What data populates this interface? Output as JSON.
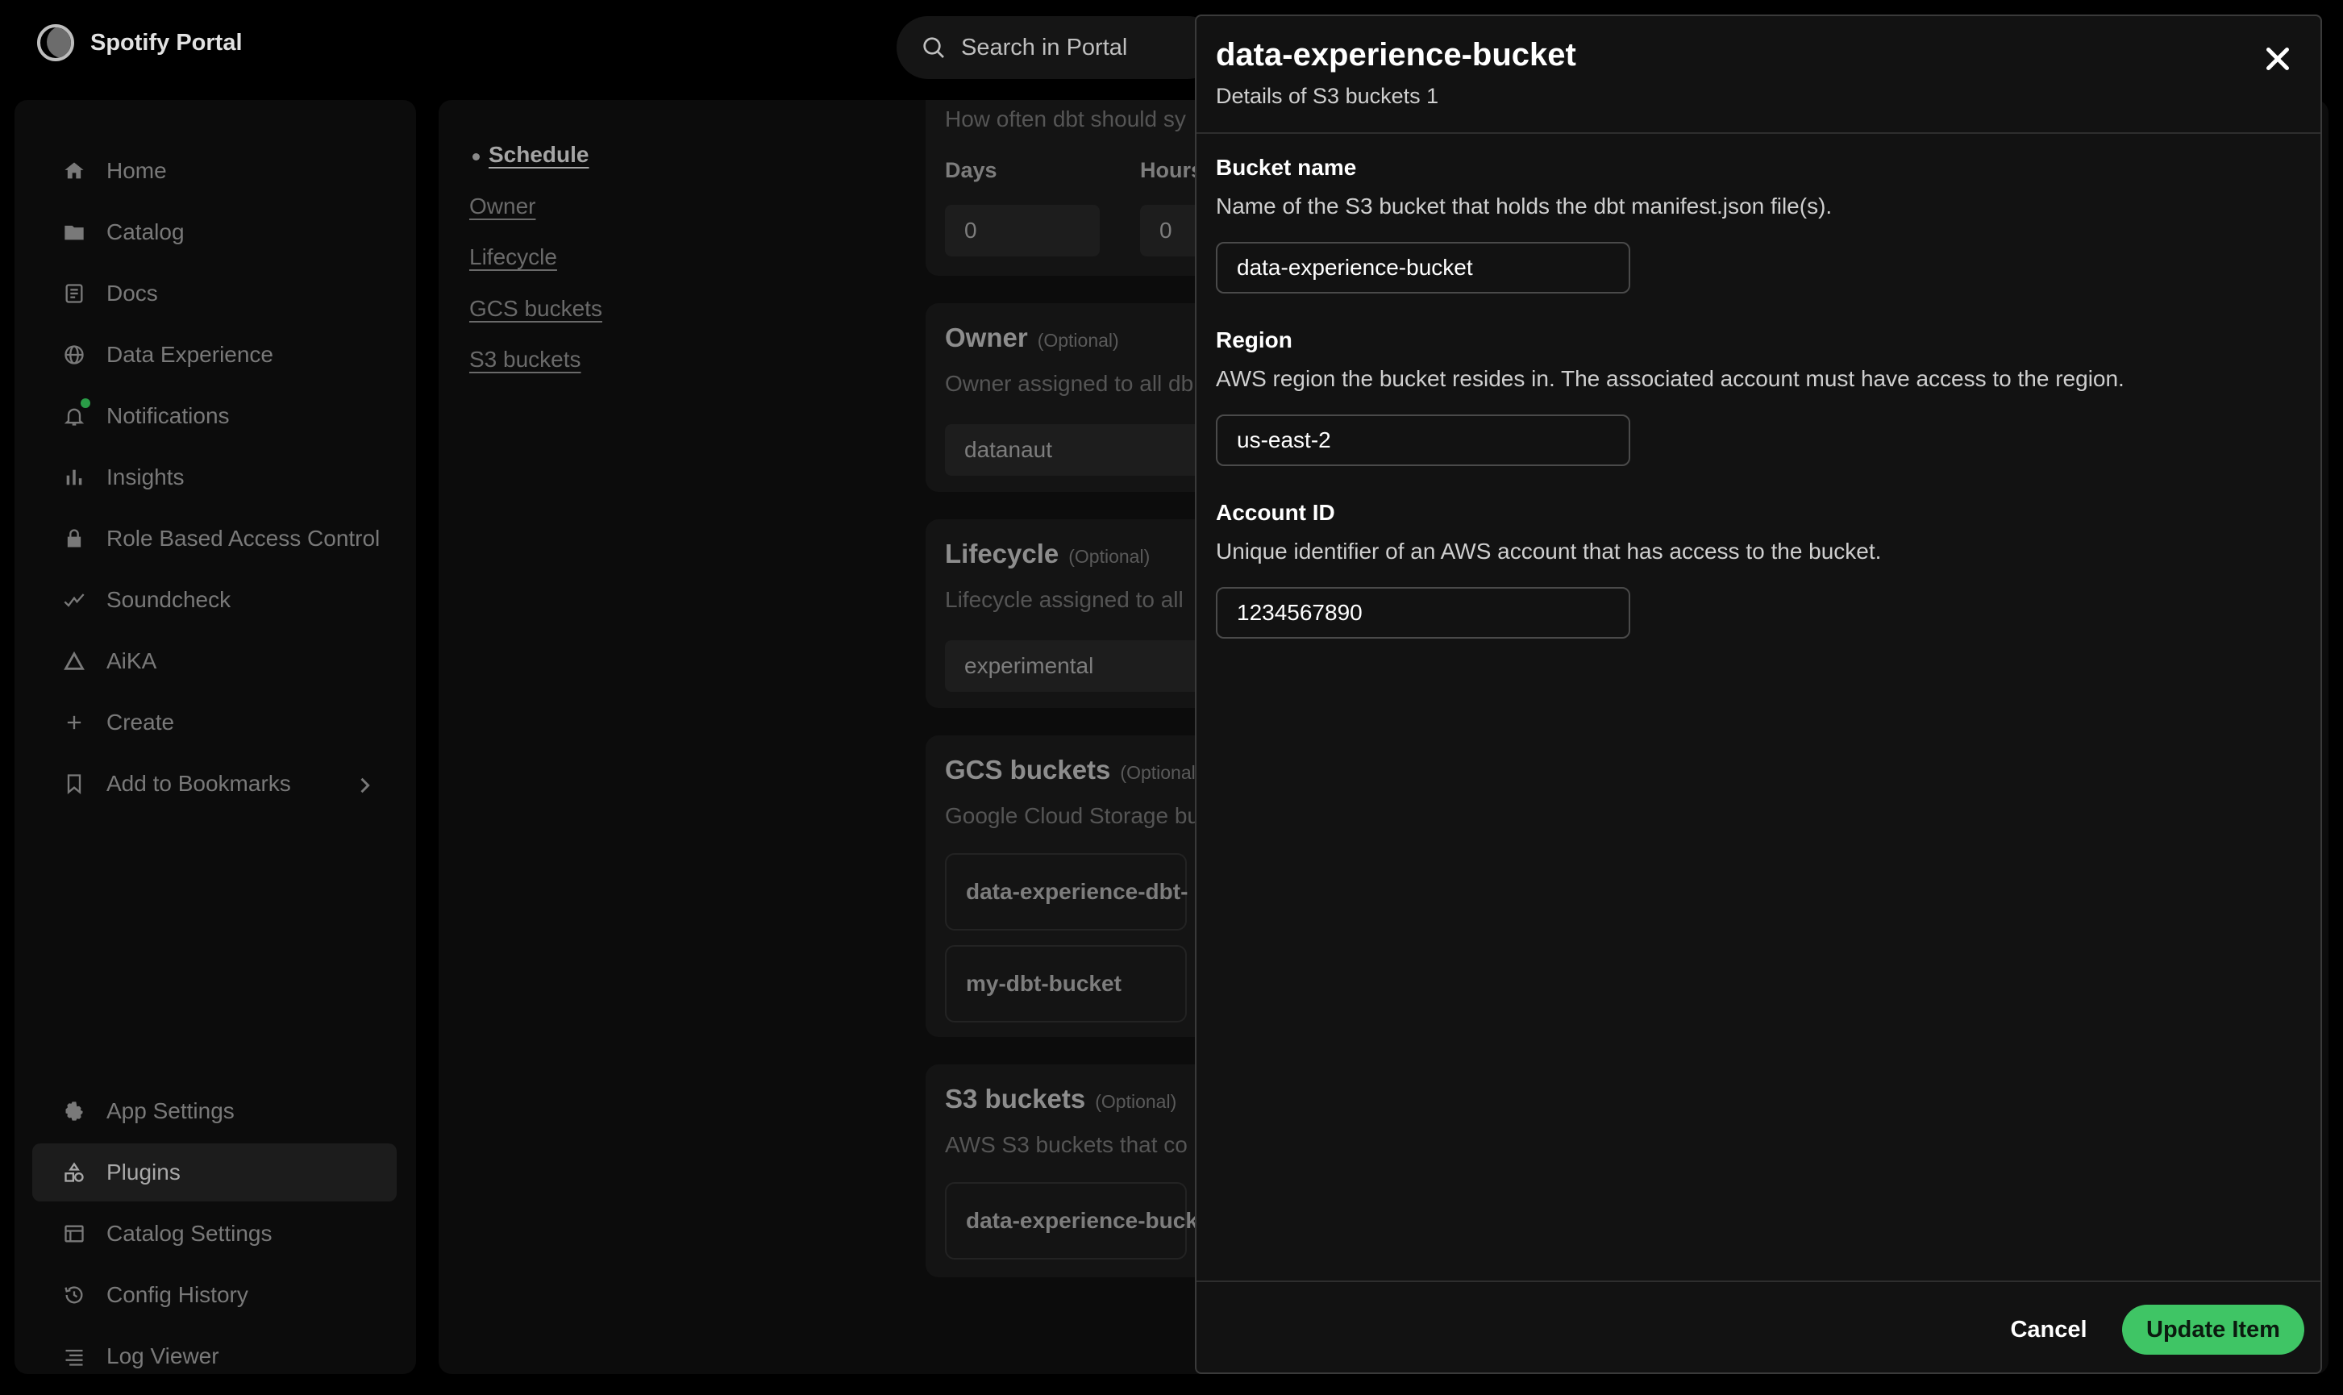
{
  "app": {
    "name": "Spotify Portal"
  },
  "search": {
    "placeholder": "Search in Portal"
  },
  "sidebar": {
    "items": [
      {
        "label": "Home",
        "icon": "home-icon"
      },
      {
        "label": "Catalog",
        "icon": "folder-icon"
      },
      {
        "label": "Docs",
        "icon": "docs-icon"
      },
      {
        "label": "Data Experience",
        "icon": "globe-icon"
      },
      {
        "label": "Notifications",
        "icon": "bell-icon"
      },
      {
        "label": "Insights",
        "icon": "bar-chart-icon"
      },
      {
        "label": "Role Based Access Control",
        "icon": "lock-icon"
      },
      {
        "label": "Soundcheck",
        "icon": "check-wave-icon"
      },
      {
        "label": "AiKA",
        "icon": "triangle-icon"
      },
      {
        "label": "Create",
        "icon": "plus-icon"
      },
      {
        "label": "Add to Bookmarks",
        "icon": "bookmark-icon"
      }
    ],
    "bottom_items": [
      {
        "label": "App Settings",
        "icon": "gear-icon"
      },
      {
        "label": "Plugins",
        "icon": "plugin-icon",
        "active": true
      },
      {
        "label": "Catalog Settings",
        "icon": "catalog-settings-icon"
      },
      {
        "label": "Config History",
        "icon": "history-icon"
      },
      {
        "label": "Log Viewer",
        "icon": "log-icon"
      }
    ]
  },
  "toc": {
    "items": [
      "Schedule",
      "Owner",
      "Lifecycle",
      "GCS buckets",
      "S3 buckets"
    ]
  },
  "config": {
    "schedule": {
      "desc": "How often dbt should sy",
      "days_label": "Days",
      "days_value": "0",
      "hours_label": "Hours",
      "hours_value": "0"
    },
    "owner": {
      "title": "Owner",
      "optional": "(Optional)",
      "desc": "Owner assigned to all db",
      "value": "datanaut"
    },
    "lifecycle": {
      "title": "Lifecycle",
      "optional": "(Optional)",
      "desc": "Lifecycle assigned to all",
      "value": "experimental"
    },
    "gcs": {
      "title": "GCS buckets",
      "optional": "(Optional",
      "desc": "Google Cloud Storage bu",
      "items": [
        "data-experience-dbt-",
        "my-dbt-bucket"
      ]
    },
    "s3": {
      "title": "S3 buckets",
      "optional": "(Optional)",
      "desc": "AWS S3 buckets that co",
      "items": [
        "data-experience-buck"
      ]
    }
  },
  "drawer": {
    "title": "data-experience-bucket",
    "subtitle": "Details of S3 buckets 1",
    "fields": {
      "bucket_name": {
        "label": "Bucket name",
        "help": "Name of the S3 bucket that holds the dbt manifest.json file(s).",
        "value": "data-experience-bucket"
      },
      "region": {
        "label": "Region",
        "help": "AWS region the bucket resides in. The associated account must have access to the region.",
        "value": "us-east-2"
      },
      "account_id": {
        "label": "Account ID",
        "help": "Unique identifier of an AWS account that has access to the bucket.",
        "value": "1234567890"
      }
    },
    "cancel_label": "Cancel",
    "update_label": "Update Item"
  },
  "colors": {
    "accent": "#3fc565",
    "notification_dot": "#2a9d47",
    "panel": "#121212"
  }
}
